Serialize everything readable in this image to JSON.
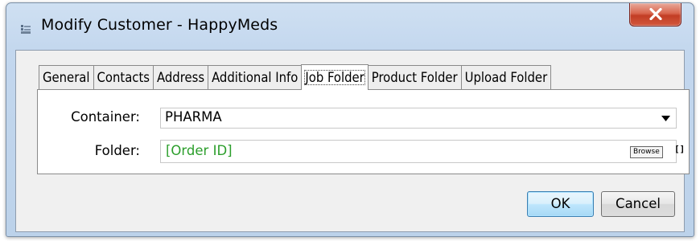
{
  "window": {
    "title": "Modify Customer - HappyMeds",
    "close_icon": "close-x-icon",
    "app_icon": "app-icon"
  },
  "tabs": [
    {
      "label": "General",
      "active": false
    },
    {
      "label": "Contacts",
      "active": false
    },
    {
      "label": "Address",
      "active": false
    },
    {
      "label": "Additional Info",
      "active": false
    },
    {
      "label": "Job Folder",
      "active": true
    },
    {
      "label": "Product Folder",
      "active": false
    },
    {
      "label": "Upload Folder",
      "active": false
    }
  ],
  "form": {
    "container_label": "Container:",
    "container_value": "PHARMA",
    "folder_label": "Folder:",
    "folder_value": "[Order ID]",
    "folder_value_color": "#2b9e2b",
    "browse_label": "Browse",
    "brackets_label": "[]"
  },
  "buttons": {
    "ok_label": "OK",
    "cancel_label": "Cancel"
  },
  "colors": {
    "title_bar": "#c3d7ee",
    "close_button": "#c23d24",
    "ok_border": "#3c7fb1"
  }
}
